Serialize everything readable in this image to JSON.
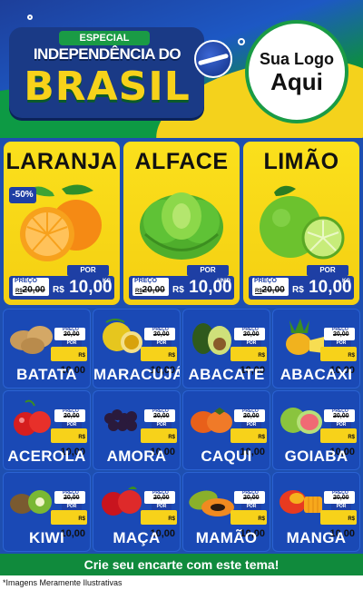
{
  "header": {
    "kicker": "ESPECIAL",
    "title_line1": "INDEPENDÊNCIA DO",
    "title_line2": "BRASIL",
    "logo_line1": "Sua Logo",
    "logo_line2": "Aqui"
  },
  "featured": [
    {
      "name": "LARANJA",
      "badge": "-50%",
      "preco_label": "PREÇO",
      "old_price": "20,00",
      "por_label": "POR",
      "currency": "R$",
      "price": "10,00",
      "unit": "KG",
      "icon": "orange-icon"
    },
    {
      "name": "ALFACE",
      "badge": "",
      "preco_label": "PREÇO",
      "old_price": "20,00",
      "por_label": "POR",
      "currency": "R$",
      "price": "10,00",
      "unit": "UNID",
      "icon": "lettuce-icon"
    },
    {
      "name": "LIMÃO",
      "badge": "",
      "preco_label": "PREÇO",
      "old_price": "20,00",
      "por_label": "POR",
      "currency": "R$",
      "price": "10,00",
      "unit": "KG",
      "icon": "lime-icon"
    }
  ],
  "grid_price": {
    "preco_label": "PREÇO",
    "old_price": "20,00",
    "por_label": "POR",
    "currency": "R$",
    "price": "10,00"
  },
  "products": [
    {
      "name": "BATATA",
      "icon": "potato-icon"
    },
    {
      "name": "MARACUJÁ",
      "icon": "passionfruit-icon"
    },
    {
      "name": "ABACATE",
      "icon": "avocado-icon"
    },
    {
      "name": "ABACAXI",
      "icon": "pineapple-icon"
    },
    {
      "name": "ACEROLA",
      "icon": "acerola-icon"
    },
    {
      "name": "AMORA",
      "icon": "blackberry-icon"
    },
    {
      "name": "CAQUI",
      "icon": "persimmon-icon"
    },
    {
      "name": "GOIABA",
      "icon": "guava-icon"
    },
    {
      "name": "KIWI",
      "icon": "kiwi-icon"
    },
    {
      "name": "MAÇA",
      "icon": "apple-icon"
    },
    {
      "name": "MAMÃO",
      "icon": "papaya-icon"
    },
    {
      "name": "MANGA",
      "icon": "mango-icon"
    }
  ],
  "footer": {
    "cta": "Crie seu encarte com este tema!",
    "note": "*Imagens Meramente Ilustrativas"
  },
  "colors": {
    "blue": "#1e4fb0",
    "yellow": "#f7d21a",
    "green": "#108a3c"
  }
}
